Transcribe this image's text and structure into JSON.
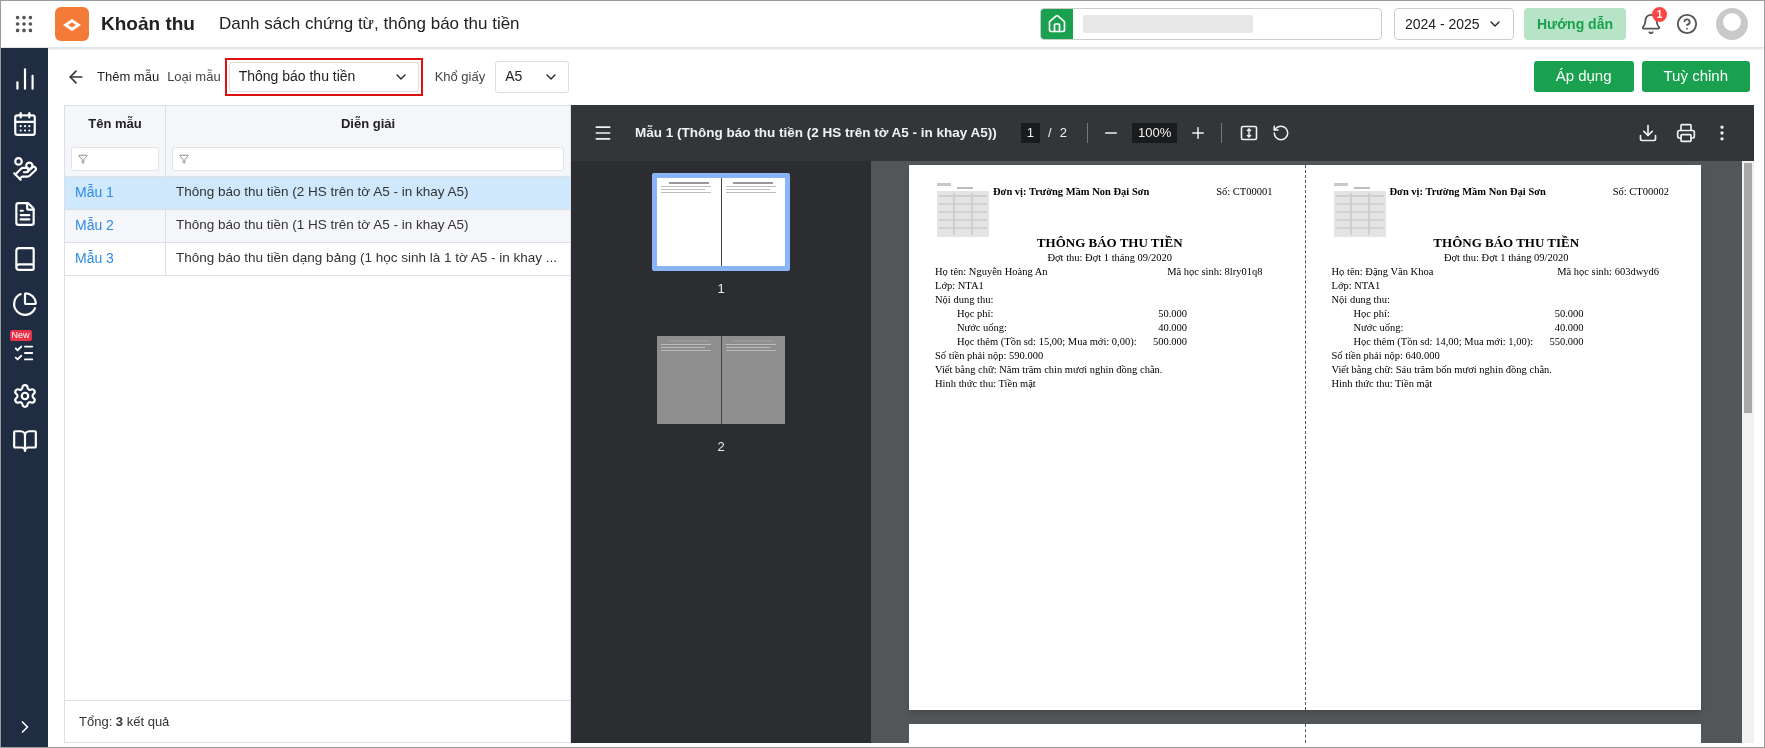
{
  "header": {
    "app_name": "Khoản thu",
    "page_title": "Danh sách chứng từ, thông báo thu tiền",
    "school_year": "2024 - 2025",
    "guide_button": "Hướng dẫn",
    "notification_count": "1"
  },
  "sidebar": {
    "new_badge": "New"
  },
  "toolbar": {
    "back_label": "Thêm mẫu",
    "template_type_label": "Loại mẫu",
    "template_type": "Thông báo thu tiền",
    "paper_size_label": "Khổ giấy",
    "paper_size": "A5",
    "buttons": [
      "Áp dụng",
      "Tuỳ chỉnh"
    ]
  },
  "table": {
    "columns": [
      "Tên mẫu",
      "Diễn giải"
    ],
    "rows": [
      {
        "name": "Mẫu 1",
        "description": "Thông báo thu tiền (2 HS trên tờ A5 - in khay A5)",
        "selected": true
      },
      {
        "name": "Mẫu 2",
        "description": "Thông báo thu tiền (1 HS trên tờ A5 - in khay A5)",
        "selected": false
      },
      {
        "name": "Mẫu 3",
        "description": "Thông báo thu tiền dạng bảng (1 học sinh là 1 tờ A5 - in khay ...",
        "selected": false
      }
    ],
    "footer": "Tổng: **3** kết quả"
  },
  "viewer": {
    "title": "Mẫu 1 (Thông báo thu tiền (2 HS trên tờ A5 - in khay A5))",
    "page": "1",
    "page_separator": "/",
    "page_count": "2",
    "zoom": "100%",
    "thumbnails": [
      {
        "label": "1",
        "selected": true
      },
      {
        "label": "2",
        "selected": false
      }
    ]
  },
  "document": {
    "notices": [
      {
        "unit": "Đơn vị: Trường Mầm Non Đại Sơn",
        "number": "Số: CT00001",
        "title": "THÔNG BÁO THU TIỀN",
        "period": "Đợt thu: Đợt 1 tháng 09/2020",
        "student_name": "Họ tên: Nguyễn Hoàng An",
        "student_code": "Mã học sinh: 8lry01q8",
        "class": "Lớp: NTA1",
        "content_label": "Nội dung thu:",
        "items": [
          {
            "label": "Học phí:",
            "amount": "50.000"
          },
          {
            "label": "Nước uống:",
            "amount": "40.000"
          },
          {
            "label": "Học thêm (Tồn sd: 15,00; Mua mới: 0,00):",
            "amount": "500.000"
          }
        ],
        "total": "Số tiền phải nộp: 590.000",
        "in_words": "Viết bằng chữ: Năm trăm chin mươi nghin đồng chẵn.",
        "method": "Hinh thức thu: Tiền mặt"
      },
      {
        "unit": "Đơn vị: Trường Mầm Non Đại Sơn",
        "number": "Số: CT00002",
        "title": "THÔNG BÁO THU TIỀN",
        "period": "Đợt thu: Đợt 1 tháng 09/2020",
        "student_name": "Họ tên: Đặng Văn Khoa",
        "student_code": "Mã học sinh: 603dwyd6",
        "class": "Lớp: NTA1",
        "content_label": "Nội dung thu:",
        "items": [
          {
            "label": "Học phí:",
            "amount": "50.000"
          },
          {
            "label": "Nước uống:",
            "amount": "40.000"
          },
          {
            "label": "Học thêm (Tồn sd: 14,00; Mua mới: 1,00):",
            "amount": "550.000"
          }
        ],
        "total": "Số tiền phải nộp: 640.000",
        "in_words": "Viết bằng chữ: Sáu trăm bốn mươi nghin đồng chẵn.",
        "method": "Hinh thức thu: Tiền mặt"
      }
    ]
  }
}
